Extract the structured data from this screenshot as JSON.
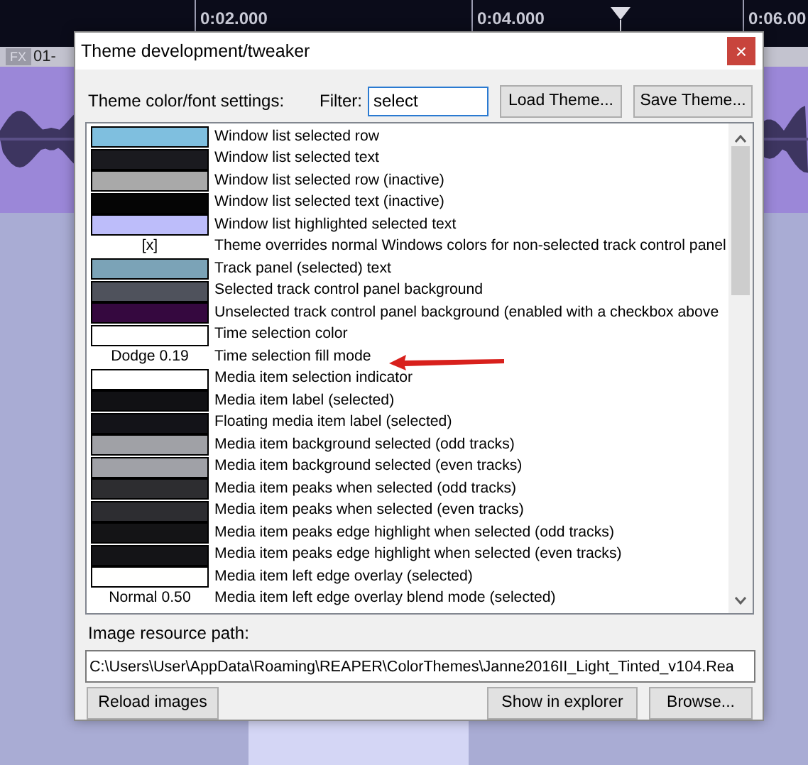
{
  "timeline": {
    "ticks": [
      "0:02.000",
      "0:04.000",
      "0:06.00"
    ]
  },
  "track": {
    "buttons": [
      "FX"
    ],
    "label": "01-"
  },
  "dialog": {
    "title": "Theme development/tweaker",
    "close": "×",
    "settings_label": "Theme color/font settings:",
    "filter_label": "Filter:",
    "filter_value": "select",
    "top_buttons": [
      "Load Theme...",
      "Save Theme..."
    ],
    "settings": [
      {
        "kind": "swatch",
        "color": "#7fbfdf",
        "label": "Window list selected row"
      },
      {
        "kind": "swatch",
        "color": "#1a1a1f",
        "label": "Window list selected text"
      },
      {
        "kind": "swatch",
        "color": "#a9a9a9",
        "label": "Window list selected row (inactive)"
      },
      {
        "kind": "swatch",
        "color": "#050505",
        "label": "Window list selected text (inactive)"
      },
      {
        "kind": "swatch",
        "color": "#bdbdfa",
        "label": "Window list highlighted selected text"
      },
      {
        "kind": "value",
        "value": "[x]",
        "label": "Theme overrides normal Windows colors for non-selected track control panel"
      },
      {
        "kind": "swatch",
        "color": "#7ba3b7",
        "label": "Track panel (selected) text"
      },
      {
        "kind": "swatch",
        "color": "#4f525c",
        "label": "Selected track control panel background"
      },
      {
        "kind": "swatch",
        "color": "#35083f",
        "label": "Unselected track control panel background (enabled with a checkbox above"
      },
      {
        "kind": "swatch",
        "color": "#ffffff",
        "label": "Time selection color"
      },
      {
        "kind": "value",
        "value": "Dodge 0.19",
        "label": "Time selection fill mode"
      },
      {
        "kind": "swatch",
        "color": "#ffffff",
        "label": "Media item selection indicator"
      },
      {
        "kind": "swatch",
        "color": "#111114",
        "label": "Media item label (selected)"
      },
      {
        "kind": "swatch",
        "color": "#131318",
        "label": "Floating media item label (selected)"
      },
      {
        "kind": "swatch",
        "color": "#a0a1a6",
        "label": "Media item background selected (odd tracks)"
      },
      {
        "kind": "swatch",
        "color": "#a0a1a7",
        "label": "Media item background selected (even tracks)"
      },
      {
        "kind": "swatch",
        "color": "#2d2d30",
        "label": "Media item peaks when selected (odd tracks)"
      },
      {
        "kind": "swatch",
        "color": "#2d2d31",
        "label": "Media item peaks when selected (even tracks)"
      },
      {
        "kind": "swatch",
        "color": "#141416",
        "label": "Media item peaks edge highlight when selected (odd tracks)"
      },
      {
        "kind": "swatch",
        "color": "#141417",
        "label": "Media item peaks edge highlight when selected (even tracks)"
      },
      {
        "kind": "swatch",
        "color": "#fffffe",
        "label": "Media item left edge overlay (selected)"
      },
      {
        "kind": "value",
        "value": "Normal 0.50",
        "label": "Media item left edge overlay blend mode (selected)"
      }
    ],
    "path_label": "Image resource path:",
    "path_value": "C:\\Users\\User\\AppData\\Roaming\\REAPER\\ColorThemes\\Janne2016II_Light_Tinted_v104.Rea",
    "bottom_buttons": [
      "Reload images",
      "Show in explorer",
      "Browse..."
    ]
  }
}
